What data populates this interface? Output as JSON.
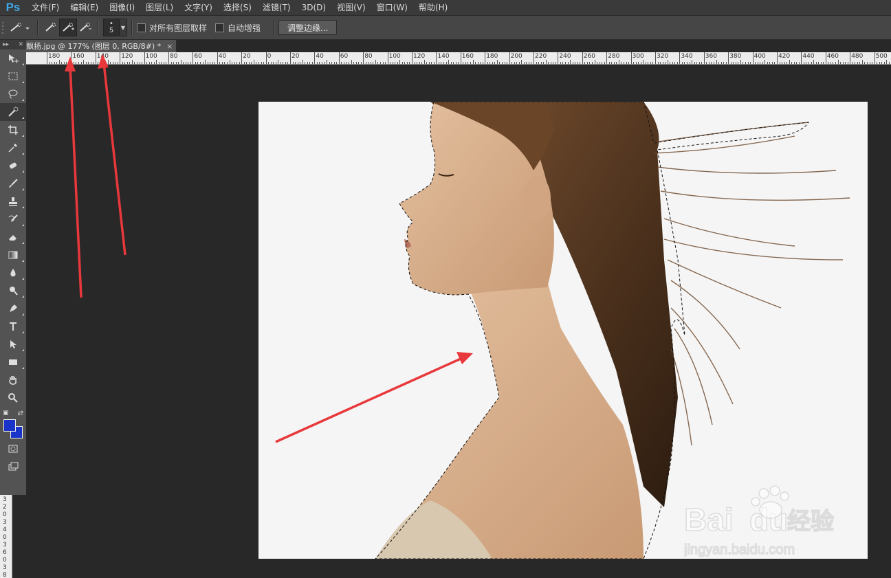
{
  "app": {
    "logo": "Ps"
  },
  "menu": [
    "文件(F)",
    "编辑(E)",
    "图像(I)",
    "图层(L)",
    "文字(Y)",
    "选择(S)",
    "滤镜(T)",
    "3D(D)",
    "视图(V)",
    "窗口(W)",
    "帮助(H)"
  ],
  "options": {
    "brush_size": "5",
    "sample_all_layers": "对所有图层取样",
    "auto_enhance": "自动增强",
    "refine_edge": "调整边缘..."
  },
  "document": {
    "tab_title": "飘扬.jpg @ 177% (图层 0, RGB/8#) *",
    "close_glyph": "×"
  },
  "ruler": {
    "h_labels": [
      "180",
      "160",
      "140",
      "120",
      "100",
      "80",
      "60",
      "40",
      "20",
      "0",
      "20",
      "40",
      "60",
      "80",
      "100",
      "120",
      "140",
      "160",
      "180",
      "200",
      "220",
      "240",
      "260",
      "280",
      "300",
      "320",
      "340",
      "360",
      "380",
      "400",
      "420",
      "440",
      "460",
      "480",
      "500"
    ],
    "v_labels": [
      "3",
      "2",
      "0",
      "3",
      "4",
      "0",
      "3",
      "6",
      "0",
      "3",
      "8"
    ]
  },
  "colors": {
    "foreground": "#1a33c8",
    "background": "#1a33c8",
    "annotation_arrow": "#e8383b",
    "app_bg": "#282828"
  },
  "tools": [
    "move-icon",
    "marquee-icon",
    "lasso-icon",
    "quick-selection-icon",
    "crop-icon",
    "eyedropper-icon",
    "healing-brush-icon",
    "brush-icon",
    "clone-stamp-icon",
    "history-brush-icon",
    "eraser-icon",
    "gradient-icon",
    "blur-icon",
    "dodge-icon",
    "pen-icon",
    "type-icon",
    "path-selection-icon",
    "rectangle-icon",
    "hand-icon",
    "zoom-icon"
  ],
  "watermark": {
    "brand": "Bai",
    "brand_suffix": "du",
    "cn": "经验",
    "url": "jingyan.baidu.com"
  }
}
